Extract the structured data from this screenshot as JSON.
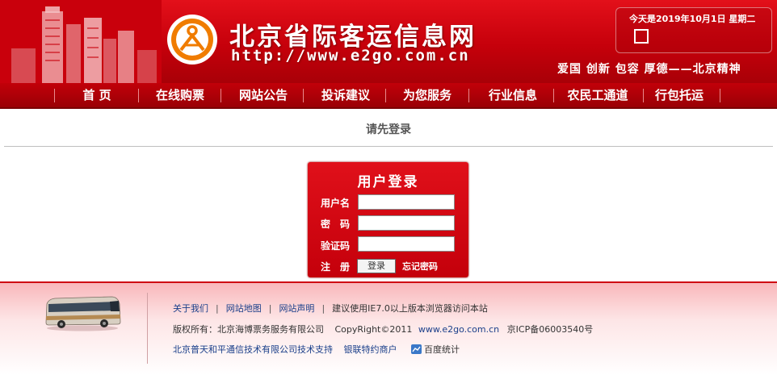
{
  "header": {
    "site_title": "北京省际客运信息网",
    "site_url": "http://www.e2go.com.cn",
    "date_text": "今天是2019年10月1日 星期二",
    "motto": "爱国  创新  包容  厚德——北京精神"
  },
  "nav": {
    "items": [
      "首 页",
      "在线购票",
      "网站公告",
      "投诉建议",
      "为您服务",
      "行业信息",
      "农民工通道",
      "行包托运"
    ]
  },
  "main": {
    "heading": "请先登录"
  },
  "login": {
    "title": "用户登录",
    "username_label": "用户名",
    "password_label": "密　码",
    "captcha_label": "验证码",
    "register_label": "注　册",
    "login_button": "登录",
    "forgot_link": "忘记密码"
  },
  "footer": {
    "links": [
      "关于我们",
      "网站地图",
      "网站声明"
    ],
    "browser_note": "建议使用IE7.0以上版本浏览器访问本站",
    "copyright_owner": "版权所有：北京海博票务服务有限公司",
    "copyright": "CopyRight©2011",
    "copyright_domain": "www.e2go.com.cn",
    "icp": "京ICP备06003540号",
    "tech_support": "北京普天和平通信技术有限公司技术支持",
    "unionpay": "银联特约商户",
    "stats": "百度统计"
  },
  "colors": {
    "header_red": "#d10a14",
    "nav_red": "#b00008",
    "link_blue": "#1a3f8a"
  }
}
